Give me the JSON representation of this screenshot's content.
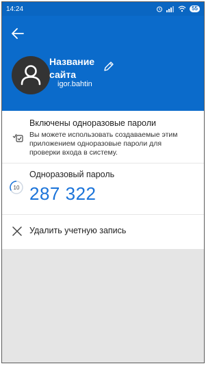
{
  "status_bar": {
    "time": "14:24",
    "battery": "55"
  },
  "header": {
    "site_name": "Название сайта",
    "account": "igor.bahtin"
  },
  "otp_enabled": {
    "title": "Включены одноразовые пароли",
    "description": "Вы можете использовать создаваемые этим приложением одноразовые пароли для проверки входа в систему."
  },
  "otp": {
    "label": "Одноразовый пароль",
    "code": "287 322",
    "seconds_left": "10"
  },
  "delete": {
    "label": "Удалить учетную запись"
  },
  "colors": {
    "header_bg": "#0b6bcb",
    "code_color": "#1a73d9",
    "empty_bg": "#e5e5e5"
  },
  "icons": [
    "back-arrow-icon",
    "avatar-person-icon",
    "pencil-icon",
    "otp-check-icon",
    "timer-icon",
    "close-icon",
    "alarm-icon",
    "signal-icon",
    "wifi-icon",
    "battery-icon"
  ]
}
